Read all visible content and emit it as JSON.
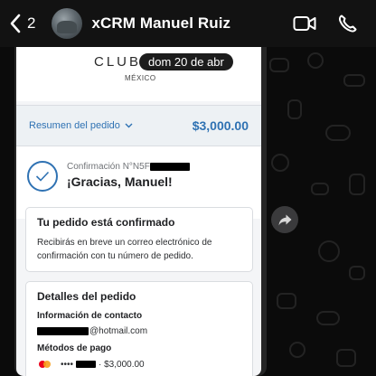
{
  "header": {
    "back_count": "2",
    "contact_name": "xCRM Manuel Ruiz",
    "icons": [
      "back-chevron-icon",
      "video-call-icon",
      "phone-icon"
    ]
  },
  "message": {
    "date_badge": "dom 20 de abr",
    "receipt": {
      "brand": "CLUB",
      "country": "MÉXICO",
      "summary_label": "Resumen del pedido",
      "summary_total": "$3,000.00",
      "confirmation_label": "Confirmación N°N5F",
      "thanks": "¡Gracias, Manuel!",
      "confirmed_card": {
        "title": "Tu pedido está confirmado",
        "body": "Recibirás en breve un correo electrónico de confirmación con tu número de pedido."
      },
      "details_card": {
        "title": "Detalles del pedido",
        "contact_label": "Información de contacto",
        "email_suffix": "@hotmail.com",
        "payment_label": "Métodos de pago",
        "card_dots": "••••",
        "payment_amount": "· $3,000.00"
      }
    }
  },
  "colors": {
    "accent_blue": "#2f72b3",
    "chat_background": "#0b0b0b",
    "header_background": "#121212"
  }
}
